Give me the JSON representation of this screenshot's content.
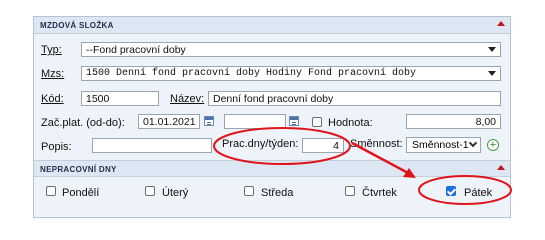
{
  "section_mzdova": {
    "title": "MZDOVÁ SLOŽKA"
  },
  "form": {
    "typ_label": "Typ:",
    "typ_value": "--Fond pracovní doby",
    "mzs_label": "Mzs:",
    "mzs_value": "1500 Denní fond pracovní doby Hodiny Fond pracovní doby",
    "kod_label": "Kód:",
    "kod_value": "1500",
    "nazev_label": "Název:",
    "nazev_value": "Denní fond pracovní doby",
    "zac_plat_label": "Zač.plat. (od-do):",
    "zac_plat_from": "01.01.2021",
    "zac_plat_to": "",
    "hodnota_label": "Hodnota:",
    "hodnota_value": "8,00",
    "popis_label": "Popis:",
    "popis_value": "",
    "prac_dny_label": "Prac.dny/týden:",
    "prac_dny_value": "4",
    "smennost_label": "Směnnost:",
    "smennost_value": "Směnnost-1"
  },
  "section_nepracovni": {
    "title": "NEPRACOVNÍ DNY",
    "days": [
      {
        "label": "Pondělí",
        "checked": false
      },
      {
        "label": "Úterý",
        "checked": false
      },
      {
        "label": "Středa",
        "checked": false
      },
      {
        "label": "Čtvrtek",
        "checked": false
      },
      {
        "label": "Pátek",
        "checked": true
      }
    ]
  },
  "colors": {
    "annotation_red": "#e0141b",
    "checkbox_checked": "#1e6fd9",
    "header_bg": "#dde7f3"
  }
}
